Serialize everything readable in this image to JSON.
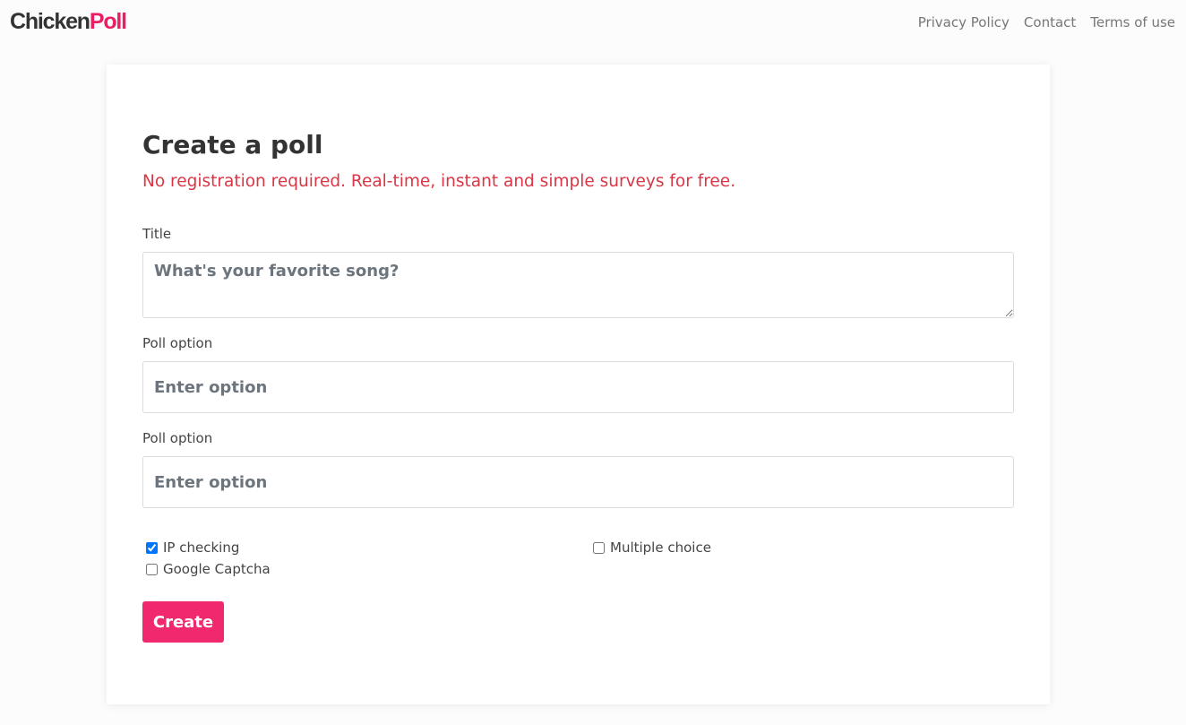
{
  "header": {
    "brand_part1": "Chicken",
    "brand_part2": "Poll",
    "links": [
      "Privacy Policy",
      "Contact",
      "Terms of use"
    ]
  },
  "form": {
    "title": "Create a poll",
    "subtitle": "No registration required. Real-time, instant and simple surveys for free.",
    "title_label": "Title",
    "title_placeholder": "What's your favorite song?",
    "option_label": "Poll option",
    "option_placeholder": "Enter option",
    "checkboxes": {
      "ip_checking": {
        "label": "IP checking",
        "checked": true
      },
      "google_captcha": {
        "label": "Google Captcha",
        "checked": false
      },
      "multiple_choice": {
        "label": "Multiple choice",
        "checked": false
      }
    },
    "create_label": "Create"
  },
  "colors": {
    "brand_accent": "#e91e63",
    "subtitle": "#dc3545",
    "button": "#f0286d"
  }
}
